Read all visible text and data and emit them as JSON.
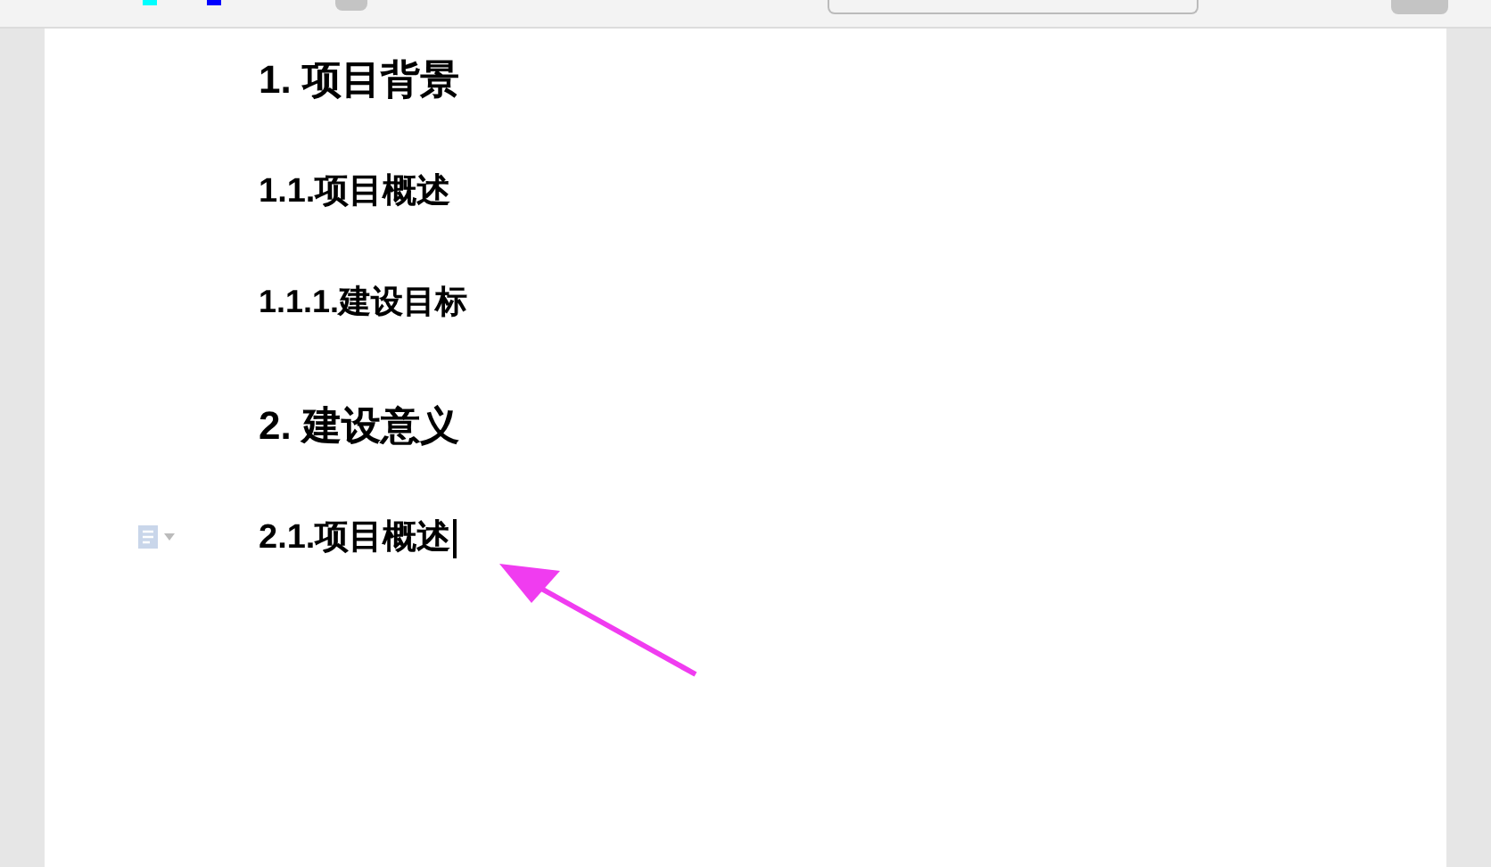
{
  "document": {
    "headings": [
      {
        "kind": "h1",
        "text": "1. 项目背景",
        "cursor": false,
        "paragraph_icon": false
      },
      {
        "kind": "h2",
        "text": "1.1.项目概述",
        "cursor": false,
        "paragraph_icon": false
      },
      {
        "kind": "h3",
        "text": "1.1.1.建设目标",
        "cursor": false,
        "paragraph_icon": false
      },
      {
        "kind": "h1",
        "text": "2. 建设意义",
        "cursor": false,
        "paragraph_icon": false
      },
      {
        "kind": "h2",
        "text": "2.1.项目概述",
        "cursor": true,
        "paragraph_icon": true
      }
    ]
  }
}
